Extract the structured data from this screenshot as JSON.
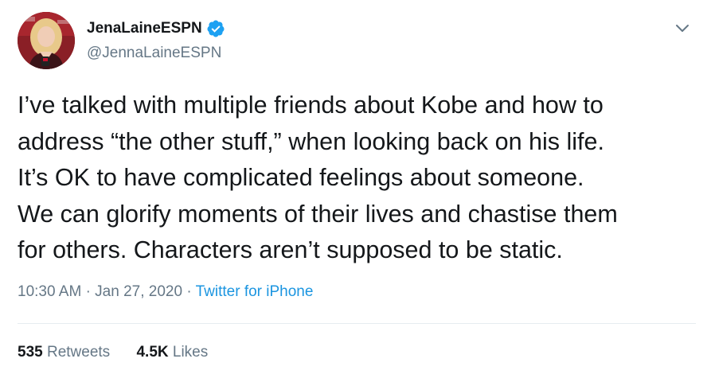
{
  "user": {
    "display_name": "JenaLaineESPN",
    "handle": "@JennaLaineESPN",
    "verified": true
  },
  "tweet": {
    "text": "I’ve talked with multiple friends about Kobe and how to\naddress “the other stuff,” when looking back on his life.\nIt’s OK to have complicated feelings about someone.\nWe can glorify moments of their lives and chastise them\nfor others. Characters aren’t supposed to be static.",
    "time": "10:30 AM",
    "separator": "·",
    "date": "Jan 27, 2020",
    "source": "Twitter for iPhone"
  },
  "stats": {
    "retweets_count": "535",
    "retweets_label": "Retweets",
    "likes_count": "4.5K",
    "likes_label": "Likes"
  },
  "icons": {
    "verified": "verified-badge-icon",
    "menu": "chevron-down-icon"
  },
  "colors": {
    "link": "#1b95e0",
    "secondary": "#657786",
    "primary_text": "#14171a",
    "verified": "#1da1f2"
  }
}
